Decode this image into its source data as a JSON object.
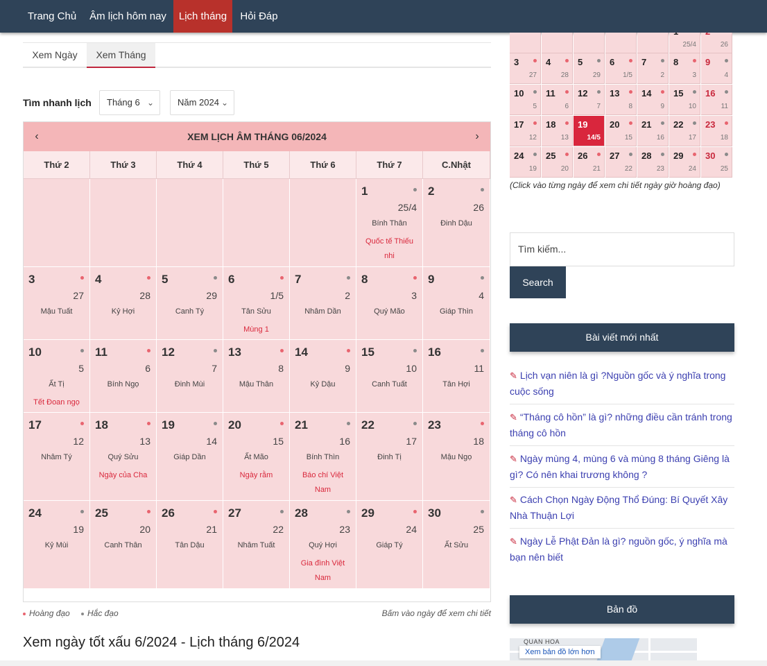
{
  "nav": [
    {
      "label": "Trang Chủ",
      "active": false
    },
    {
      "label": "Âm lịch hôm nay",
      "active": false
    },
    {
      "label": "Lịch tháng",
      "active": true
    },
    {
      "label": "Hỏi Đáp",
      "active": false
    }
  ],
  "tabs": [
    {
      "label": "Xem Ngày",
      "active": false
    },
    {
      "label": "Xem Tháng",
      "active": true
    }
  ],
  "quick": {
    "label": "Tìm nhanh lịch",
    "month": "Tháng 6",
    "year": "Năm 2024"
  },
  "calendar": {
    "title": "XEM LỊCH ÂM THÁNG 06/2024",
    "prev": "‹",
    "next": "›",
    "weekdays": [
      "Thứ 2",
      "Thứ 3",
      "Thứ 4",
      "Thứ 5",
      "Thứ 6",
      "Thứ 7",
      "C.Nhật"
    ],
    "days": [
      {
        "d": "1",
        "lunar": "25/4",
        "cc": "Bính Thân",
        "event": "Quốc tế Thiếu nhi",
        "dot": "gray"
      },
      {
        "d": "2",
        "lunar": "26",
        "cc": "Đinh Dậu",
        "event": "",
        "dot": "gray"
      },
      {
        "d": "3",
        "lunar": "27",
        "cc": "Mậu Tuất",
        "event": "",
        "dot": "red"
      },
      {
        "d": "4",
        "lunar": "28",
        "cc": "Kỷ Hợi",
        "event": "",
        "dot": "red"
      },
      {
        "d": "5",
        "lunar": "29",
        "cc": "Canh Tý",
        "event": "",
        "dot": "gray"
      },
      {
        "d": "6",
        "lunar": "1/5",
        "cc": "Tân Sửu",
        "event": "Mùng 1",
        "dot": "red"
      },
      {
        "d": "7",
        "lunar": "2",
        "cc": "Nhâm Dần",
        "event": "",
        "dot": "gray"
      },
      {
        "d": "8",
        "lunar": "3",
        "cc": "Quý Mão",
        "event": "",
        "dot": "red"
      },
      {
        "d": "9",
        "lunar": "4",
        "cc": "Giáp Thìn",
        "event": "",
        "dot": "gray"
      },
      {
        "d": "10",
        "lunar": "5",
        "cc": "Ất Tị",
        "event": "Tết Đoan ngọ",
        "dot": "gray"
      },
      {
        "d": "11",
        "lunar": "6",
        "cc": "Bính Ngọ",
        "event": "",
        "dot": "red"
      },
      {
        "d": "12",
        "lunar": "7",
        "cc": "Đinh Mùi",
        "event": "",
        "dot": "gray"
      },
      {
        "d": "13",
        "lunar": "8",
        "cc": "Mậu Thân",
        "event": "",
        "dot": "red"
      },
      {
        "d": "14",
        "lunar": "9",
        "cc": "Kỷ Dậu",
        "event": "",
        "dot": "red"
      },
      {
        "d": "15",
        "lunar": "10",
        "cc": "Canh Tuất",
        "event": "",
        "dot": "gray"
      },
      {
        "d": "16",
        "lunar": "11",
        "cc": "Tân Hợi",
        "event": "",
        "dot": "gray"
      },
      {
        "d": "17",
        "lunar": "12",
        "cc": "Nhâm Tý",
        "event": "",
        "dot": "red"
      },
      {
        "d": "18",
        "lunar": "13",
        "cc": "Quý Sửu",
        "event": "Ngày của Cha",
        "dot": "red"
      },
      {
        "d": "19",
        "lunar": "14",
        "cc": "Giáp Dần",
        "event": "",
        "dot": "gray"
      },
      {
        "d": "20",
        "lunar": "15",
        "cc": "Ất Mão",
        "event": "Ngày rằm",
        "dot": "red"
      },
      {
        "d": "21",
        "lunar": "16",
        "cc": "Bính Thìn",
        "event": "Báo chí Việt Nam",
        "dot": "gray"
      },
      {
        "d": "22",
        "lunar": "17",
        "cc": "Đinh Tị",
        "event": "",
        "dot": "gray"
      },
      {
        "d": "23",
        "lunar": "18",
        "cc": "Mậu Ngọ",
        "event": "",
        "dot": "red"
      },
      {
        "d": "24",
        "lunar": "19",
        "cc": "Kỷ Mùi",
        "event": "",
        "dot": "gray"
      },
      {
        "d": "25",
        "lunar": "20",
        "cc": "Canh Thân",
        "event": "",
        "dot": "red"
      },
      {
        "d": "26",
        "lunar": "21",
        "cc": "Tân Dậu",
        "event": "",
        "dot": "red"
      },
      {
        "d": "27",
        "lunar": "22",
        "cc": "Nhâm Tuất",
        "event": "",
        "dot": "gray"
      },
      {
        "d": "28",
        "lunar": "23",
        "cc": "Quý Hợi",
        "event": "Gia đình Việt Nam",
        "dot": "gray"
      },
      {
        "d": "29",
        "lunar": "24",
        "cc": "Giáp Tý",
        "event": "",
        "dot": "red"
      },
      {
        "d": "30",
        "lunar": "25",
        "cc": "Ất Sửu",
        "event": "",
        "dot": "gray"
      }
    ]
  },
  "legend": {
    "good": "Hoàng đạo",
    "bad": "Hắc đạo",
    "hint": "Bấm vào ngày để xem chi tiết"
  },
  "bottom_title": "Xem ngày tốt xấu 6/2024 - Lịch tháng 6/2024",
  "mini": {
    "partial_row": [
      {
        "d": "1",
        "lunar": "25/4",
        "dot": "gray",
        "red": false
      },
      {
        "d": "2",
        "lunar": "26",
        "dot": "gray",
        "red": true
      }
    ],
    "rows": [
      [
        {
          "d": "3",
          "lunar": "27",
          "dot": "red"
        },
        {
          "d": "4",
          "lunar": "28",
          "dot": "red"
        },
        {
          "d": "5",
          "lunar": "29",
          "dot": "gray"
        },
        {
          "d": "6",
          "lunar": "1/5",
          "dot": "red"
        },
        {
          "d": "7",
          "lunar": "2",
          "dot": "gray"
        },
        {
          "d": "8",
          "lunar": "3",
          "dot": "red"
        },
        {
          "d": "9",
          "lunar": "4",
          "dot": "gray",
          "red": true
        }
      ],
      [
        {
          "d": "10",
          "lunar": "5",
          "dot": "gray"
        },
        {
          "d": "11",
          "lunar": "6",
          "dot": "red"
        },
        {
          "d": "12",
          "lunar": "7",
          "dot": "gray"
        },
        {
          "d": "13",
          "lunar": "8",
          "dot": "red"
        },
        {
          "d": "14",
          "lunar": "9",
          "dot": "red"
        },
        {
          "d": "15",
          "lunar": "10",
          "dot": "gray"
        },
        {
          "d": "16",
          "lunar": "11",
          "dot": "gray",
          "red": true
        }
      ],
      [
        {
          "d": "17",
          "lunar": "12",
          "dot": "red"
        },
        {
          "d": "18",
          "lunar": "13",
          "dot": "red"
        },
        {
          "d": "19",
          "lunar": "14/5",
          "dot": "gray",
          "today": true
        },
        {
          "d": "20",
          "lunar": "15",
          "dot": "red"
        },
        {
          "d": "21",
          "lunar": "16",
          "dot": "gray"
        },
        {
          "d": "22",
          "lunar": "17",
          "dot": "gray"
        },
        {
          "d": "23",
          "lunar": "18",
          "dot": "red",
          "red": true
        }
      ],
      [
        {
          "d": "24",
          "lunar": "19",
          "dot": "gray"
        },
        {
          "d": "25",
          "lunar": "20",
          "dot": "red"
        },
        {
          "d": "26",
          "lunar": "21",
          "dot": "red"
        },
        {
          "d": "27",
          "lunar": "22",
          "dot": "gray"
        },
        {
          "d": "28",
          "lunar": "23",
          "dot": "gray"
        },
        {
          "d": "29",
          "lunar": "24",
          "dot": "red"
        },
        {
          "d": "30",
          "lunar": "25",
          "dot": "gray",
          "red": true
        }
      ]
    ],
    "note": "(Click vào từng ngày để xem chi tiết ngày giờ hoàng đạo)"
  },
  "search": {
    "placeholder": "Tìm kiếm...",
    "button": "Search"
  },
  "recent": {
    "title": "Bài viết mới nhất",
    "posts": [
      "Lịch vạn niên là gì ?Nguồn gốc và ý nghĩa trong cuộc sống",
      "“Tháng cô hồn” là gì? những điều cần tránh trong tháng cô hồn",
      "Ngày mùng 4, mùng 6 và mùng 8 tháng Giêng là gì? Có nên khai trương không ?",
      "Cách Chọn Ngày Động Thổ Đúng: Bí Quyết Xây Nhà Thuận Lợi",
      "Ngày Lễ Phật Đản là gì? nguồn gốc, ý nghĩa mà bạn nên biết"
    ]
  },
  "map": {
    "title": "Bản đồ",
    "place": "QUAN HOA",
    "link": "Xem bản đồ lớn hơn"
  },
  "colors": {
    "navbar": "#2f4358",
    "active": "#b8312b",
    "cell": "#f8d9db",
    "header": "#f4b6b8",
    "today": "#d9263d",
    "good_dot": "#e8646f",
    "bad_dot": "#8a8a8a"
  }
}
